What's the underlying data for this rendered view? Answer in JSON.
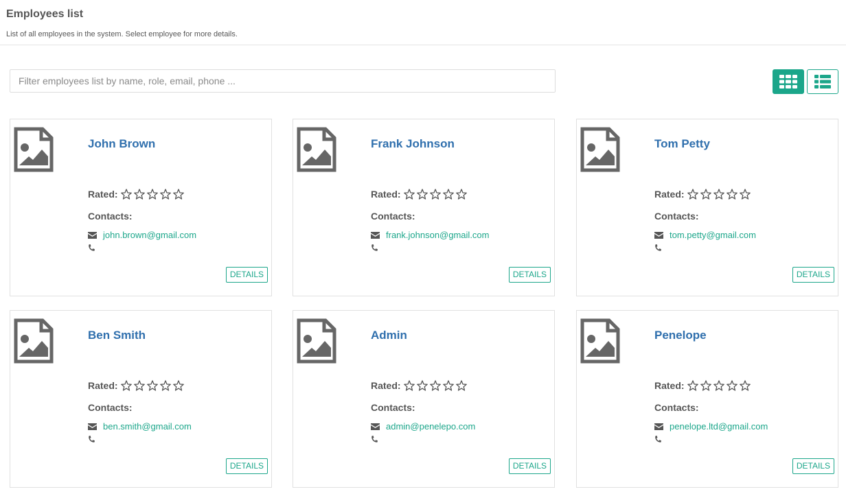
{
  "header": {
    "title": "Employees list",
    "subtitle": "List of all employees in the system. Select employee for more details."
  },
  "filter": {
    "placeholder": "Filter employees list by name, role, email, phone ...",
    "value": ""
  },
  "view_toggle": {
    "active": "grid",
    "grid_icon": "grid-icon",
    "list_icon": "list-icon"
  },
  "colors": {
    "accent": "#1ba68a",
    "name_link": "#2f6fad",
    "text": "#555555"
  },
  "labels": {
    "rated": "Rated:",
    "contacts": "Contacts:",
    "details": "DETAILS"
  },
  "employees": [
    {
      "name": "John Brown",
      "email": "john.brown@gmail.com",
      "phone": "",
      "rating": 0,
      "max_rating": 5
    },
    {
      "name": "Frank Johnson",
      "email": "frank.johnson@gmail.com",
      "phone": "",
      "rating": 0,
      "max_rating": 5
    },
    {
      "name": "Tom Petty",
      "email": "tom.petty@gmail.com",
      "phone": "",
      "rating": 0,
      "max_rating": 5
    },
    {
      "name": "Ben Smith",
      "email": "ben.smith@gmail.com",
      "phone": "",
      "rating": 0,
      "max_rating": 5
    },
    {
      "name": "Admin",
      "email": "admin@penelepo.com",
      "phone": "",
      "rating": 0,
      "max_rating": 5
    },
    {
      "name": "Penelope",
      "email": "penelope.ltd@gmail.com",
      "phone": "",
      "rating": 0,
      "max_rating": 5
    }
  ]
}
